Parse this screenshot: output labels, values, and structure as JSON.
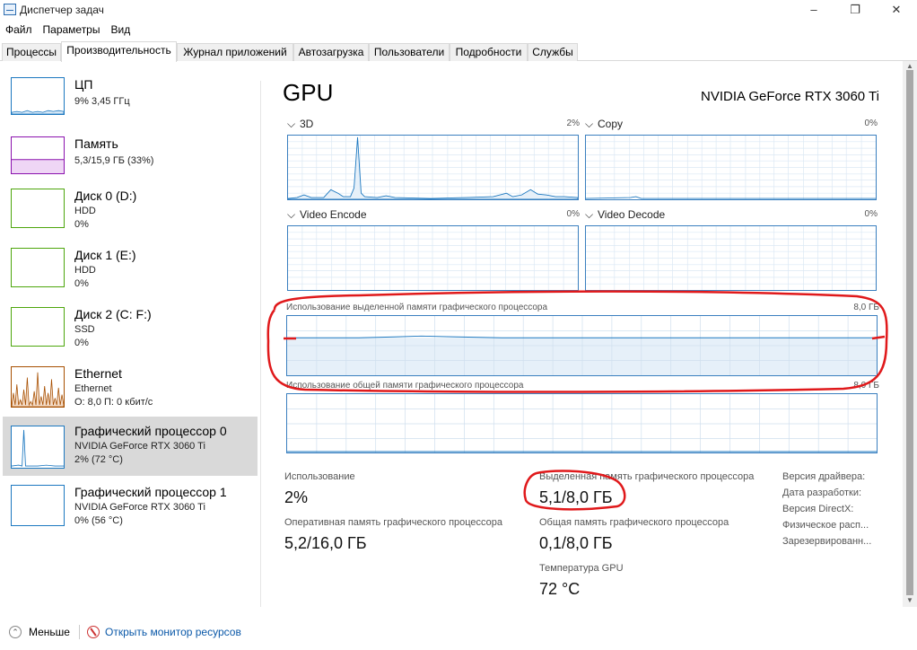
{
  "window": {
    "title": "Диспетчер задач",
    "min": "–",
    "max": "❐",
    "close": "✕"
  },
  "menu": [
    "Файл",
    "Параметры",
    "Вид"
  ],
  "tabs": [
    "Процессы",
    "Производительность",
    "Журнал приложений",
    "Автозагрузка",
    "Пользователи",
    "Подробности",
    "Службы"
  ],
  "sidebar": [
    {
      "title": "ЦП",
      "line1": "9% 3,45 ГГц",
      "line2": "",
      "line3": ""
    },
    {
      "title": "Память",
      "line1": "5,3/15,9 ГБ (33%)",
      "line2": "",
      "line3": ""
    },
    {
      "title": "Диск 0 (D:)",
      "line1": "HDD",
      "line2": "0%",
      "line3": ""
    },
    {
      "title": "Диск 1 (E:)",
      "line1": "HDD",
      "line2": "0%",
      "line3": ""
    },
    {
      "title": "Диск 2 (C: F:)",
      "line1": "SSD",
      "line2": "0%",
      "line3": ""
    },
    {
      "title": "Ethernet",
      "line1": "Ethernet",
      "line2": "О: 8,0  П: 0 кбит/с",
      "line3": ""
    },
    {
      "title": "Графический процессор 0",
      "line1": "NVIDIA GeForce RTX 3060 Ti",
      "line2": "2% (72 °C)",
      "line3": ""
    },
    {
      "title": "Графический процессор 1",
      "line1": "NVIDIA GeForce RTX 3060 Ti",
      "line2": "0% (56 °C)",
      "line3": ""
    }
  ],
  "main": {
    "title": "GPU",
    "model": "NVIDIA GeForce RTX 3060 Ti",
    "engines": [
      {
        "name": "3D",
        "pct": "2%",
        "chevron": "⌵"
      },
      {
        "name": "Copy",
        "pct": "0%",
        "chevron": "⌵"
      },
      {
        "name": "Video Encode",
        "pct": "0%",
        "chevron": "⌵"
      },
      {
        "name": "Video Decode",
        "pct": "0%",
        "chevron": "⌵"
      }
    ],
    "dedicated_label": "Использование выделенной памяти графического процессора",
    "dedicated_max": "8,0 ГБ",
    "shared_label": "Использование общей памяти графического процессора",
    "shared_max": "8,0 ГБ",
    "stats": {
      "usage_label": "Использование",
      "usage_value": "2%",
      "gpu_ram_label": "Оперативная память графического процессора",
      "gpu_ram_value": "5,2/16,0 ГБ",
      "dedicated_label": "Выделенная память графического процессора",
      "dedicated_value": "5,1/8,0 ГБ",
      "shared_label": "Общая память графического процессора",
      "shared_value": "0,1/8,0 ГБ",
      "temp_label": "Температура GPU",
      "temp_value": "72 °C"
    },
    "right": [
      "Версия драйвера:",
      "Дата разработки:",
      "Версия DirectX:",
      "Физическое расп...",
      "Зарезервированн..."
    ]
  },
  "footer": {
    "less": "Меньше",
    "less_icon": "⌃",
    "monitor": "Открыть монитор ресурсов"
  },
  "colors": {
    "cpu": "#1c78c0",
    "memory": "#8b12ae",
    "disk": "#4da60c",
    "ethernet": "#a74f01",
    "gpu": "#1c78c0",
    "annotation": "#e0191b"
  }
}
